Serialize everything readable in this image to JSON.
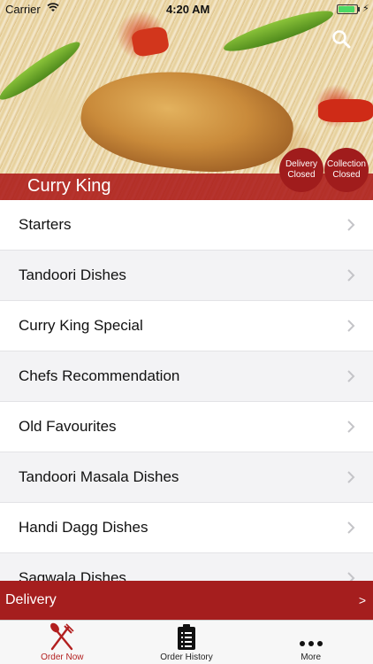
{
  "status_bar": {
    "carrier": "Carrier",
    "time": "4:20 AM",
    "battery_level": 0.9,
    "battery_color": "#4cd964"
  },
  "header": {
    "restaurant_name": "Curry King",
    "search_icon": "search-icon",
    "delivery_status": [
      "Delivery",
      "Closed"
    ],
    "collection_status": [
      "Collection",
      "Closed"
    ],
    "accent_color": "#a01c1c"
  },
  "menu": {
    "categories": [
      {
        "label": "Starters"
      },
      {
        "label": "Tandoori Dishes"
      },
      {
        "label": "Curry King Special"
      },
      {
        "label": "Chefs Recommendation"
      },
      {
        "label": "Old Favourites"
      },
      {
        "label": "Tandoori Masala Dishes"
      },
      {
        "label": "Handi Dagg Dishes"
      },
      {
        "label": "Saqwala Dishes"
      }
    ],
    "chevron_icon": "chevron-right-icon"
  },
  "order_bar": {
    "label": "Delivery",
    "arrow": ">"
  },
  "tab_bar": {
    "tabs": [
      {
        "label": "Order Now",
        "icon": "fork-knife-icon",
        "active": true
      },
      {
        "label": "Order History",
        "icon": "clipboard-icon",
        "active": false
      },
      {
        "label": "More",
        "icon": "more-dots-icon",
        "active": false
      }
    ],
    "active_color": "#b21f1f"
  }
}
